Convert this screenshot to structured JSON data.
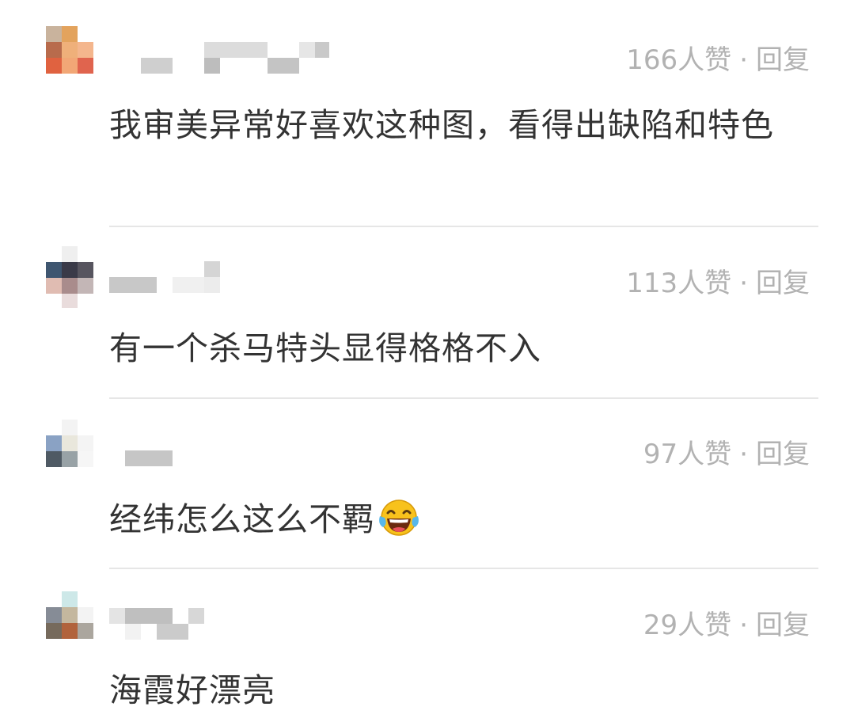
{
  "comments": [
    {
      "likes": "166人赞",
      "separator": "·",
      "reply": "回复",
      "text": "我审美异常好喜欢这种图，看得出缺陷和特色"
    },
    {
      "likes": "113人赞",
      "separator": "·",
      "reply": "回复",
      "text": "有一个杀马特头显得格格不入"
    },
    {
      "likes": "97人赞",
      "separator": "·",
      "reply": "回复",
      "text": "经纬怎么这么不羁",
      "emoji": "laughing-with-tears-emoji"
    },
    {
      "likes": "29人赞",
      "separator": "·",
      "reply": "回复",
      "text": "海霞好漂亮"
    }
  ],
  "colors": {
    "meta": "#b2b2b2",
    "text": "#333333",
    "divider": "#e6e6e6",
    "emoji_face": "#f8c21c"
  }
}
